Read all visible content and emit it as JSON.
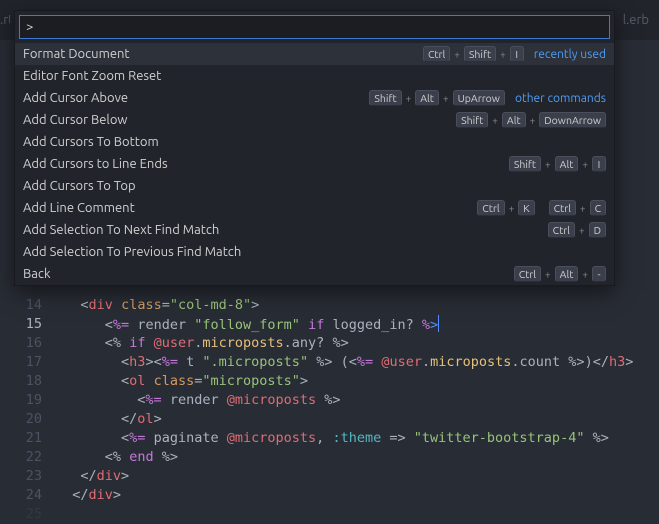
{
  "tabs": {
    "left_fragment": ".rt",
    "right_fragment": "l.erb"
  },
  "palette": {
    "query": ">",
    "categories": {
      "recent": "recently used",
      "other": "other commands"
    },
    "items": [
      {
        "label": "Format Document",
        "keys": [
          "Ctrl",
          "Shift",
          "I"
        ],
        "cat": "recent",
        "selected": true
      },
      {
        "label": "Editor Font Zoom Reset",
        "keys": [],
        "cat": ""
      },
      {
        "label": "Add Cursor Above",
        "keys": [
          "Shift",
          "Alt",
          "UpArrow"
        ],
        "cat": "other"
      },
      {
        "label": "Add Cursor Below",
        "keys": [
          "Shift",
          "Alt",
          "DownArrow"
        ],
        "cat": ""
      },
      {
        "label": "Add Cursors To Bottom",
        "keys": [],
        "cat": ""
      },
      {
        "label": "Add Cursors to Line Ends",
        "keys": [
          "Shift",
          "Alt",
          "I"
        ],
        "cat": ""
      },
      {
        "label": "Add Cursors To Top",
        "keys": [],
        "cat": ""
      },
      {
        "label": "Add Line Comment",
        "keys2": [
          [
            "Ctrl",
            "K"
          ],
          [
            "Ctrl",
            "C"
          ]
        ],
        "cat": ""
      },
      {
        "label": "Add Selection To Next Find Match",
        "keys": [
          "Ctrl",
          "D"
        ],
        "cat": ""
      },
      {
        "label": "Add Selection To Previous Find Match",
        "keys": [],
        "cat": ""
      },
      {
        "label": "Back",
        "keys": [
          "Ctrl",
          "Alt",
          "-"
        ],
        "cat": ""
      }
    ]
  },
  "editor": {
    "line_start": 14,
    "current_line": 15,
    "lines_html": [
      "<span class='pun'>&lt;</span><span class='tag'>div</span> <span class='attr'>class</span><span class='pun'>=</span><span class='str'>\"col-md-8\"</span><span class='pun'>&gt;</span>",
      "  <span class='erb'>&lt;</span><span class='kw'>%=</span> <span class='func'>render</span> <span class='str'>\"follow_form\"</span> <span class='kw'>if</span> <span class='func'>logged_in?</span> <span class='kw'>%</span><span class='highlight-char'>&gt;</span><span class='caret'></span>",
      "  <span class='erb'>&lt;%</span> <span class='kw'>if</span> <span class='ivar'>@user</span><span class='dot'>.</span><span class='var'>microposts</span><span class='dot'>.</span><span class='func'>any?</span> <span class='erb'>%&gt;</span>",
      "    <span class='pun'>&lt;</span><span class='tag'>h3</span><span class='pun'>&gt;</span><span class='erb'>&lt;</span><span class='kw'>%=</span> <span class='func'>t</span> <span class='str'>\".microposts\"</span> <span class='erb'>%&gt;</span> <span class='pun'>(</span><span class='erb'>&lt;</span><span class='kw'>%=</span> <span class='ivar'>@user</span><span class='dot'>.</span><span class='var'>microposts</span><span class='dot'>.</span><span class='func'>count</span> <span class='erb'>%&gt;</span><span class='pun'>)</span><span class='pun'>&lt;/</span><span class='tag'>h3</span><span class='pun'>&gt;</span>",
      "    <span class='pun'>&lt;</span><span class='tag'>ol</span> <span class='attr'>class</span><span class='pun'>=</span><span class='str'>\"microposts\"</span><span class='pun'>&gt;</span>",
      "      <span class='erb'>&lt;</span><span class='kw'>%=</span> <span class='func'>render</span> <span class='ivar'>@microposts</span> <span class='erb'>%&gt;</span>",
      "    <span class='pun'>&lt;/</span><span class='tag'>ol</span><span class='pun'>&gt;</span>",
      "    <span class='erb'>&lt;</span><span class='kw'>%=</span> <span class='func'>paginate</span> <span class='ivar'>@microposts</span><span class='pun'>,</span> <span class='sym'>:theme</span> <span class='op'>=&gt;</span> <span class='str'>\"twitter-bootstrap-4\"</span> <span class='erb'>%&gt;</span>",
      "  <span class='erb'>&lt;%</span> <span class='kw'>end</span> <span class='erb'>%&gt;</span>",
      "<span class='pun'>&lt;/</span><span class='tag'>div</span><span class='pun'>&gt;</span>",
      "<span class='pun'>&lt;/</span><span class='tag'>div</span><span class='pun'>&gt;</span>"
    ]
  }
}
